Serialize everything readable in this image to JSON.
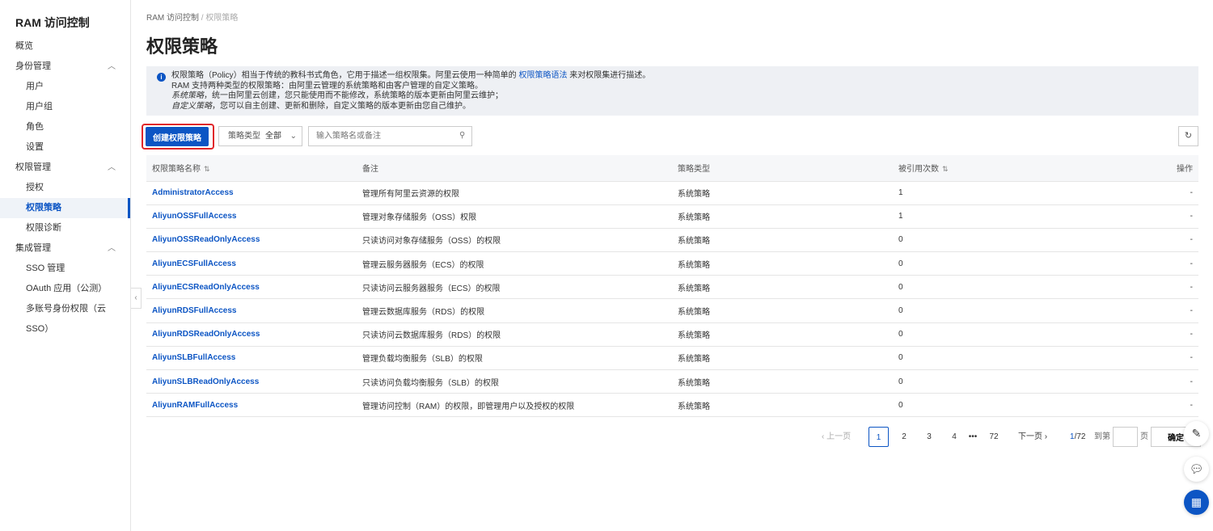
{
  "sidebar": {
    "title": "RAM 访问控制",
    "items": [
      {
        "label": "概览",
        "type": "top"
      },
      {
        "label": "身份管理",
        "type": "group"
      },
      {
        "label": "用户",
        "type": "sub"
      },
      {
        "label": "用户组",
        "type": "sub"
      },
      {
        "label": "角色",
        "type": "sub"
      },
      {
        "label": "设置",
        "type": "sub"
      },
      {
        "label": "权限管理",
        "type": "group"
      },
      {
        "label": "授权",
        "type": "sub"
      },
      {
        "label": "权限策略",
        "type": "sub",
        "active": true
      },
      {
        "label": "权限诊断",
        "type": "sub"
      },
      {
        "label": "集成管理",
        "type": "group"
      },
      {
        "label": "SSO 管理",
        "type": "sub"
      },
      {
        "label": "OAuth 应用（公测）",
        "type": "sub"
      },
      {
        "label": "多账号身份权限（云 SSO）",
        "type": "sub"
      }
    ]
  },
  "breadcrumb": {
    "root": "RAM 访问控制",
    "sep": "/",
    "current": "权限策略"
  },
  "page_title": "权限策略",
  "notice": {
    "l1a": "权限策略（Policy）相当于传统的教科书式角色，它用于描述一组权限集。阿里云使用一种简单的 ",
    "l1link": "权限策略语法",
    "l1b": " 来对权限集进行描述。",
    "l2": "RAM 支持两种类型的权限策略：由阿里云管理的系统策略和由客户管理的自定义策略。",
    "l3i": "系统策略",
    "l3": "，统一由阿里云创建，您只能使用而不能修改，系统策略的版本更新由阿里云维护；",
    "l4i": "自定义策略",
    "l4": "，您可以自主创建、更新和删除，自定义策略的版本更新由您自己维护。"
  },
  "toolbar": {
    "create": "创建权限策略",
    "type_label": "策略类型",
    "type_value": "全部",
    "search_placeholder": "输入策略名或备注"
  },
  "table": {
    "headers": [
      "权限策略名称",
      "备注",
      "策略类型",
      "被引用次数",
      "操作"
    ],
    "rows": [
      [
        "AdministratorAccess",
        "管理所有阿里云资源的权限",
        "系统策略",
        "1",
        "-"
      ],
      [
        "AliyunOSSFullAccess",
        "管理对象存储服务（OSS）权限",
        "系统策略",
        "1",
        "-"
      ],
      [
        "AliyunOSSReadOnlyAccess",
        "只读访问对象存储服务（OSS）的权限",
        "系统策略",
        "0",
        "-"
      ],
      [
        "AliyunECSFullAccess",
        "管理云服务器服务（ECS）的权限",
        "系统策略",
        "0",
        "-"
      ],
      [
        "AliyunECSReadOnlyAccess",
        "只读访问云服务器服务（ECS）的权限",
        "系统策略",
        "0",
        "-"
      ],
      [
        "AliyunRDSFullAccess",
        "管理云数据库服务（RDS）的权限",
        "系统策略",
        "0",
        "-"
      ],
      [
        "AliyunRDSReadOnlyAccess",
        "只读访问云数据库服务（RDS）的权限",
        "系统策略",
        "0",
        "-"
      ],
      [
        "AliyunSLBFullAccess",
        "管理负载均衡服务（SLB）的权限",
        "系统策略",
        "0",
        "-"
      ],
      [
        "AliyunSLBReadOnlyAccess",
        "只读访问负载均衡服务（SLB）的权限",
        "系统策略",
        "0",
        "-"
      ],
      [
        "AliyunRAMFullAccess",
        "管理访问控制（RAM）的权限，即管理用户以及授权的权限",
        "系统策略",
        "0",
        "-"
      ]
    ]
  },
  "pager": {
    "prev": "上一页",
    "pages": [
      "1",
      "2",
      "3",
      "4",
      "•••",
      "72"
    ],
    "next": "下一页",
    "current": "1",
    "total": "/72",
    "goto": "到第",
    "page_unit": "页",
    "confirm": "确定"
  }
}
